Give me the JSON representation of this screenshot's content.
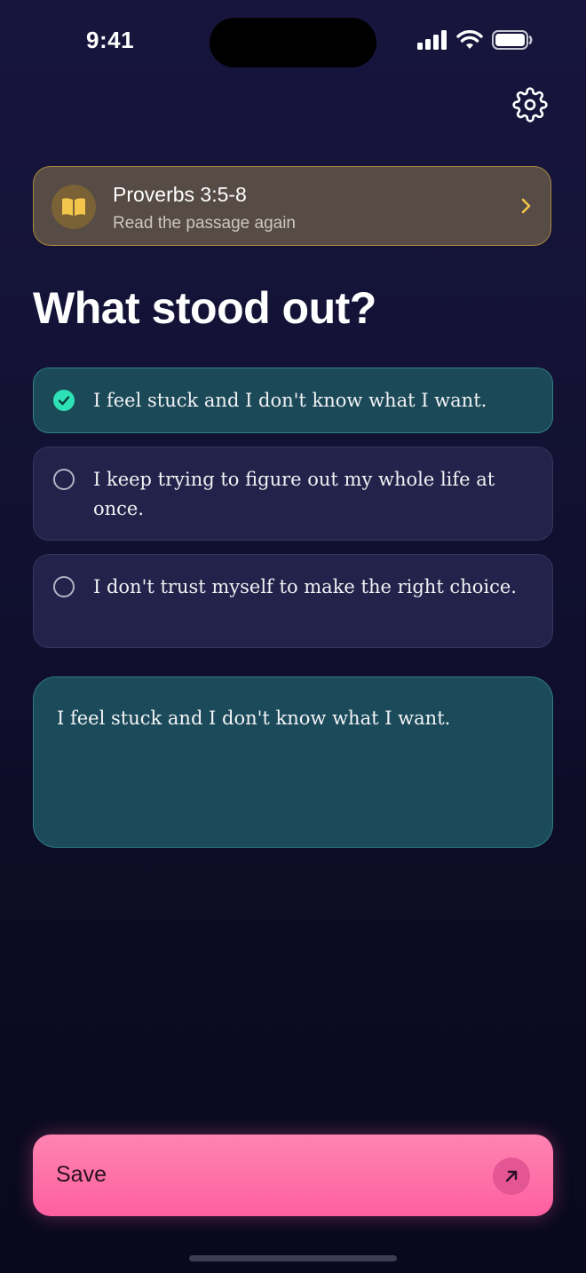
{
  "status_bar": {
    "time": "9:41"
  },
  "header": {
    "settings_icon": "gear-icon"
  },
  "passage": {
    "title": "Proverbs 3:5-8",
    "subtitle": "Read the passage again",
    "icon": "book-icon",
    "accent_color": "#f3c54a"
  },
  "question": {
    "heading": "What stood out?"
  },
  "options": [
    {
      "label": "I feel stuck and I don't know what I want.",
      "selected": true
    },
    {
      "label": "I keep trying to figure out my whole life at once.",
      "selected": false
    },
    {
      "label": "I don't trust myself to make the right choice.",
      "selected": false
    }
  ],
  "answer": {
    "value": "I feel stuck and I don't know what I want."
  },
  "save_button": {
    "label": "Save",
    "icon": "arrow-up-right-icon",
    "color": "#ff6fa8"
  },
  "colors": {
    "selected_check": "#2ee0b6",
    "selected_background": "#1b4957"
  }
}
